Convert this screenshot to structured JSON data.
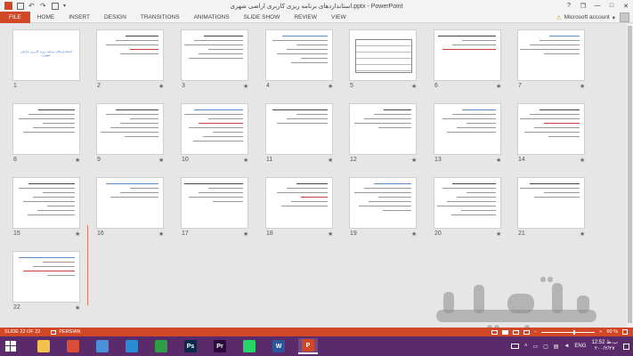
{
  "window": {
    "title": "استانداردهای برنامه ریزی کاربری اراضی شهری.pptx - PowerPoint",
    "controls": {
      "help": "?",
      "restore": "❐",
      "minimize": "—",
      "maximize": "□",
      "close": "✕"
    }
  },
  "ribbon": {
    "tabs": [
      "FILE",
      "HOME",
      "INSERT",
      "DESIGN",
      "TRANSITIONS",
      "ANIMATIONS",
      "SLIDE SHOW",
      "REVIEW",
      "VIEW"
    ],
    "account": "Microsoft account",
    "account_arrow": "▾",
    "warning_glyph": "⚠"
  },
  "slides": [
    {
      "number": "1",
      "title": "استانداردهای برنامه ریزی کاربری اراضی شهری",
      "star": false
    },
    {
      "number": "2",
      "star": true
    },
    {
      "number": "3",
      "star": true
    },
    {
      "number": "4",
      "star": true
    },
    {
      "number": "5",
      "star": true
    },
    {
      "number": "6",
      "star": true
    },
    {
      "number": "7",
      "star": true
    },
    {
      "number": "8",
      "star": true
    },
    {
      "number": "9",
      "star": true
    },
    {
      "number": "10",
      "star": true
    },
    {
      "number": "11",
      "star": true
    },
    {
      "number": "12",
      "star": true
    },
    {
      "number": "13",
      "star": true
    },
    {
      "number": "14",
      "star": true
    },
    {
      "number": "15",
      "star": true
    },
    {
      "number": "16",
      "star": true
    },
    {
      "number": "17",
      "star": true
    },
    {
      "number": "18",
      "star": true
    },
    {
      "number": "19",
      "star": true
    },
    {
      "number": "20",
      "star": true
    },
    {
      "number": "21",
      "star": true
    },
    {
      "number": "22",
      "star": true
    }
  ],
  "star_glyph": "★",
  "status": {
    "slide": "SLIDE 22 OF 22",
    "language": "PERSIAN",
    "zoom": "60 %",
    "zoom_level": 0.6,
    "minus": "−",
    "plus": "+"
  },
  "taskbar": {
    "apps": [
      {
        "name": "file-explorer",
        "glyph": "",
        "color": "#f2c14e"
      },
      {
        "name": "chrome",
        "glyph": "",
        "color": "#dd4b39"
      },
      {
        "name": "explorer-window",
        "glyph": "",
        "color": "#4a90d9"
      },
      {
        "name": "settings",
        "glyph": "",
        "color": "#2a8dd4"
      },
      {
        "name": "calculator",
        "glyph": "",
        "color": "#2e9e44"
      },
      {
        "name": "photoshop",
        "glyph": "Ps",
        "color": "#0a2a4a"
      },
      {
        "name": "premiere",
        "glyph": "Pr",
        "color": "#2a0a3a"
      },
      {
        "name": "whatsapp",
        "glyph": "",
        "color": "#25d366"
      },
      {
        "name": "word",
        "glyph": "W",
        "color": "#2b579a"
      },
      {
        "name": "powerpoint",
        "glyph": "P",
        "color": "#d24726"
      }
    ],
    "language": "ENG",
    "time": "12:52 ب.ظ",
    "date": "۲۰۰/۲/۲۷"
  },
  "watermark": {
    "text": "باساطی"
  }
}
